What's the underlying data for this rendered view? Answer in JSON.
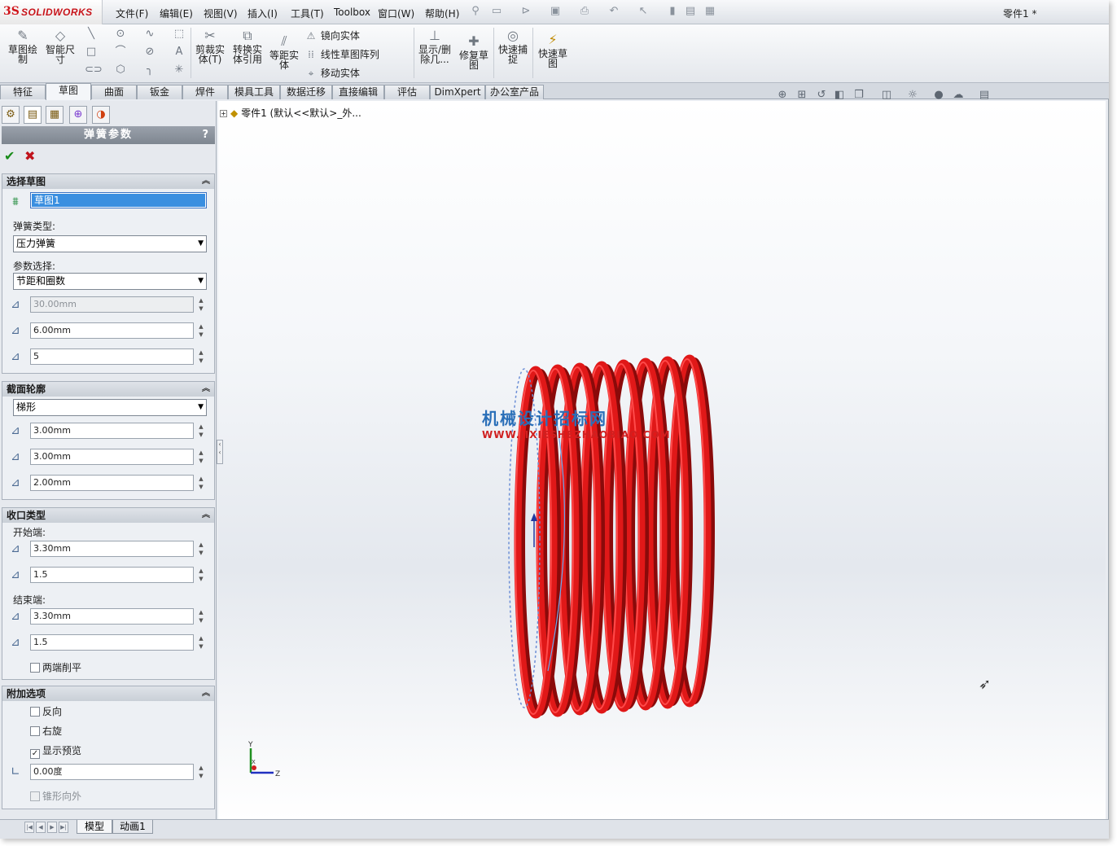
{
  "app": {
    "logo_ds": "3S",
    "logo_name": "SOLIDWORKS",
    "doc_title": "零件1 *"
  },
  "menu": [
    "文件(F)",
    "编辑(E)",
    "视图(V)",
    "插入(I)",
    "工具(T)",
    "Toolbox",
    "窗口(W)",
    "帮助(H)"
  ],
  "ribbon": {
    "sketch": "草图绘制",
    "smart_dim": "智能尺寸",
    "trim": "剪裁实体(T)",
    "convert": "转换实体引用",
    "offset": "等距实体",
    "mirror": "镜向实体",
    "linear_pattern": "线性草图阵列",
    "move": "移动实体",
    "display_delete": "显示/删除几...",
    "repair": "修复草图",
    "quick_snap": "快速捕捉",
    "rapid_sketch": "快速草图"
  },
  "tabs": [
    "特征",
    "草图",
    "曲面",
    "钣金",
    "焊件",
    "模具工具",
    "数据迁移",
    "直接编辑",
    "评估",
    "DimXpert",
    "办公室产品"
  ],
  "active_tab": "草图",
  "tree": {
    "root": "零件1  (默认<<默认>_外..."
  },
  "pm": {
    "title": "弹簧参数",
    "help": "?",
    "groups": {
      "select_sketch": {
        "title": "选择草图",
        "sketch_value": "草图1",
        "spring_type_label": "弹簧类型:",
        "spring_type": "压力弹簧",
        "param_label": "参数选择:",
        "param": "节距和圈数",
        "v1": "30.00mm",
        "v2": "6.00mm",
        "v3": "5"
      },
      "section": {
        "title": "截面轮廓",
        "shape": "梯形",
        "v1": "3.00mm",
        "v2": "3.00mm",
        "v3": "2.00mm"
      },
      "closing": {
        "title": "收口类型",
        "start_label": "开始端:",
        "start_v1": "3.30mm",
        "start_v2": "1.5",
        "end_label": "结束端:",
        "end_v1": "3.30mm",
        "end_v2": "1.5",
        "both_flat": "两端削平"
      },
      "extra": {
        "title": "附加选项",
        "reverse": "反向",
        "right_hand": "右旋",
        "show_preview": "显示预览",
        "angle": "0.00度",
        "taper_out": "锥形向外"
      }
    }
  },
  "watermark": {
    "cn": "机械设计招标网",
    "url": "WWW.JIXIESHEZHAOBIAO.COM"
  },
  "bottom_tabs": [
    "模型",
    "动画1"
  ],
  "colors": {
    "spring": "#e01818",
    "spring_dark": "#8a0a0a",
    "accent": "#3a8fe0"
  }
}
